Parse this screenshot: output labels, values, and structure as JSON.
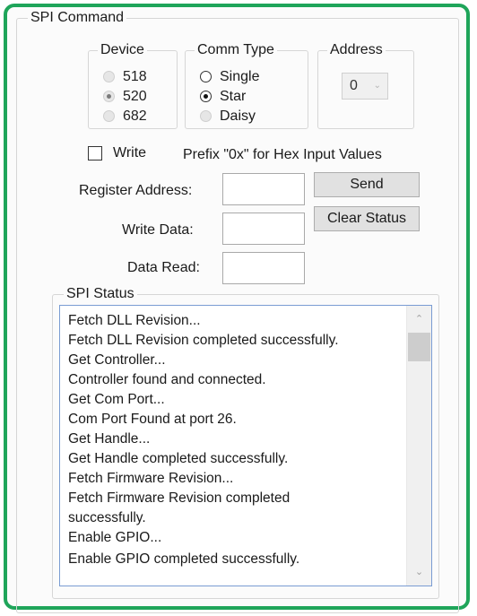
{
  "spi_command": {
    "title": "SPI Command",
    "device": {
      "title": "Device",
      "options": [
        {
          "label": "518",
          "checked": false
        },
        {
          "label": "520",
          "checked": true
        },
        {
          "label": "682",
          "checked": false
        }
      ]
    },
    "comm_type": {
      "title": "Comm Type",
      "options": [
        {
          "label": "Single",
          "checked": false
        },
        {
          "label": "Star",
          "checked": true
        },
        {
          "label": "Daisy",
          "checked": false
        }
      ]
    },
    "address": {
      "title": "Address",
      "selected": "0",
      "arrow_icon": "chevron-down-icon"
    },
    "write_checkbox": {
      "label": "Write",
      "checked": false
    },
    "hint": "Prefix \"0x\" for Hex Input Values",
    "register_address": {
      "label": "Register Address:",
      "value": ""
    },
    "write_data": {
      "label": "Write Data:",
      "value": ""
    },
    "data_read": {
      "label": "Data Read:",
      "value": ""
    },
    "buttons": {
      "send": "Send",
      "clear_status": "Clear Status"
    }
  },
  "spi_status": {
    "title": "SPI Status",
    "lines": [
      "Fetch DLL Revision...",
      "Fetch DLL Revision completed successfully.",
      "Get Controller...",
      "Controller found and connected.",
      "Get Com Port...",
      "Com Port Found at port 26.",
      "Get Handle...",
      "Get Handle completed successfully.",
      "Fetch Firmware Revision...",
      "Fetch Firmware Revision completed",
      "successfully.",
      "Enable GPIO...",
      "Enable GPIO completed successfully."
    ],
    "scroll_up_icon": "chevron-up-icon",
    "scroll_down_icon": "chevron-down-icon"
  },
  "colors": {
    "frame_border": "#1fa55a",
    "listbox_border": "#7a9cd3"
  }
}
